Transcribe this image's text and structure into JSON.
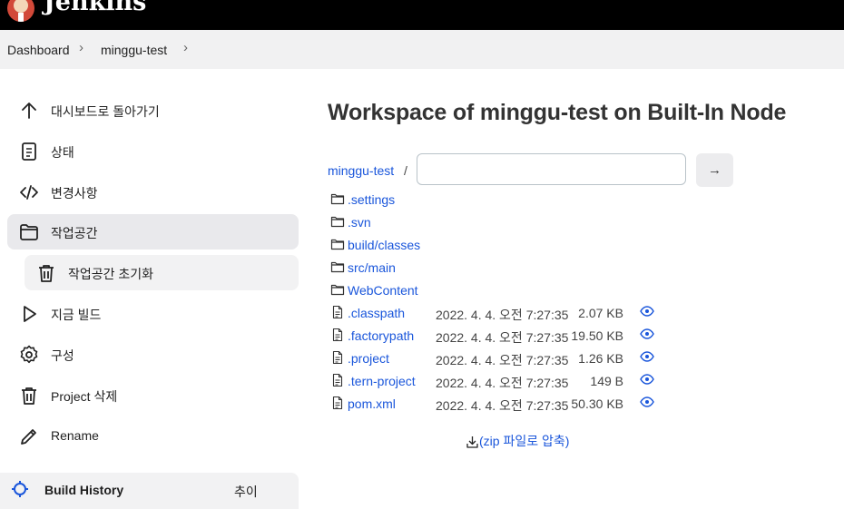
{
  "header": {
    "brand": "Jenkins"
  },
  "breadcrumb": {
    "items": [
      "Dashboard",
      "minggu-test"
    ]
  },
  "sidebar": {
    "items": [
      {
        "label": "대시보드로 돌아가기",
        "icon": "arrow-up-icon"
      },
      {
        "label": "상태",
        "icon": "document-icon"
      },
      {
        "label": "변경사항",
        "icon": "code-icon"
      },
      {
        "label": "작업공간",
        "icon": "folder-icon"
      },
      {
        "label": "작업공간 초기화",
        "icon": "trash-icon"
      },
      {
        "label": "지금 빌드",
        "icon": "play-icon"
      },
      {
        "label": "구성",
        "icon": "gear-icon"
      },
      {
        "label": "Project 삭제",
        "icon": "trash-icon"
      },
      {
        "label": "Rename",
        "icon": "pencil-icon"
      }
    ],
    "build_history": {
      "label": "Build History",
      "right": "추이"
    }
  },
  "main": {
    "title": "Workspace of minggu-test on Built-In Node",
    "path_root": "minggu-test",
    "path_separator": "/",
    "path_input_value": "",
    "go_label": "→",
    "folders": [
      ".settings",
      ".svn",
      "build/classes",
      "src/main",
      "WebContent"
    ],
    "files": [
      {
        "name": ".classpath",
        "date": "2022. 4. 4. 오전 7:27:35",
        "size": "2.07 KB"
      },
      {
        "name": ".factorypath",
        "date": "2022. 4. 4. 오전 7:27:35",
        "size": "19.50 KB"
      },
      {
        "name": ".project",
        "date": "2022. 4. 4. 오전 7:27:35",
        "size": "1.26 KB"
      },
      {
        "name": ".tern-project",
        "date": "2022. 4. 4. 오전 7:27:35",
        "size": "149 B"
      },
      {
        "name": "pom.xml",
        "date": "2022. 4. 4. 오전 7:27:35",
        "size": "50.30 KB"
      }
    ],
    "zip_label": "(zip 파일로 압축)"
  },
  "colors": {
    "link": "#1a56db",
    "header_bg": "#000000",
    "active_bg": "#e9e9ec"
  }
}
